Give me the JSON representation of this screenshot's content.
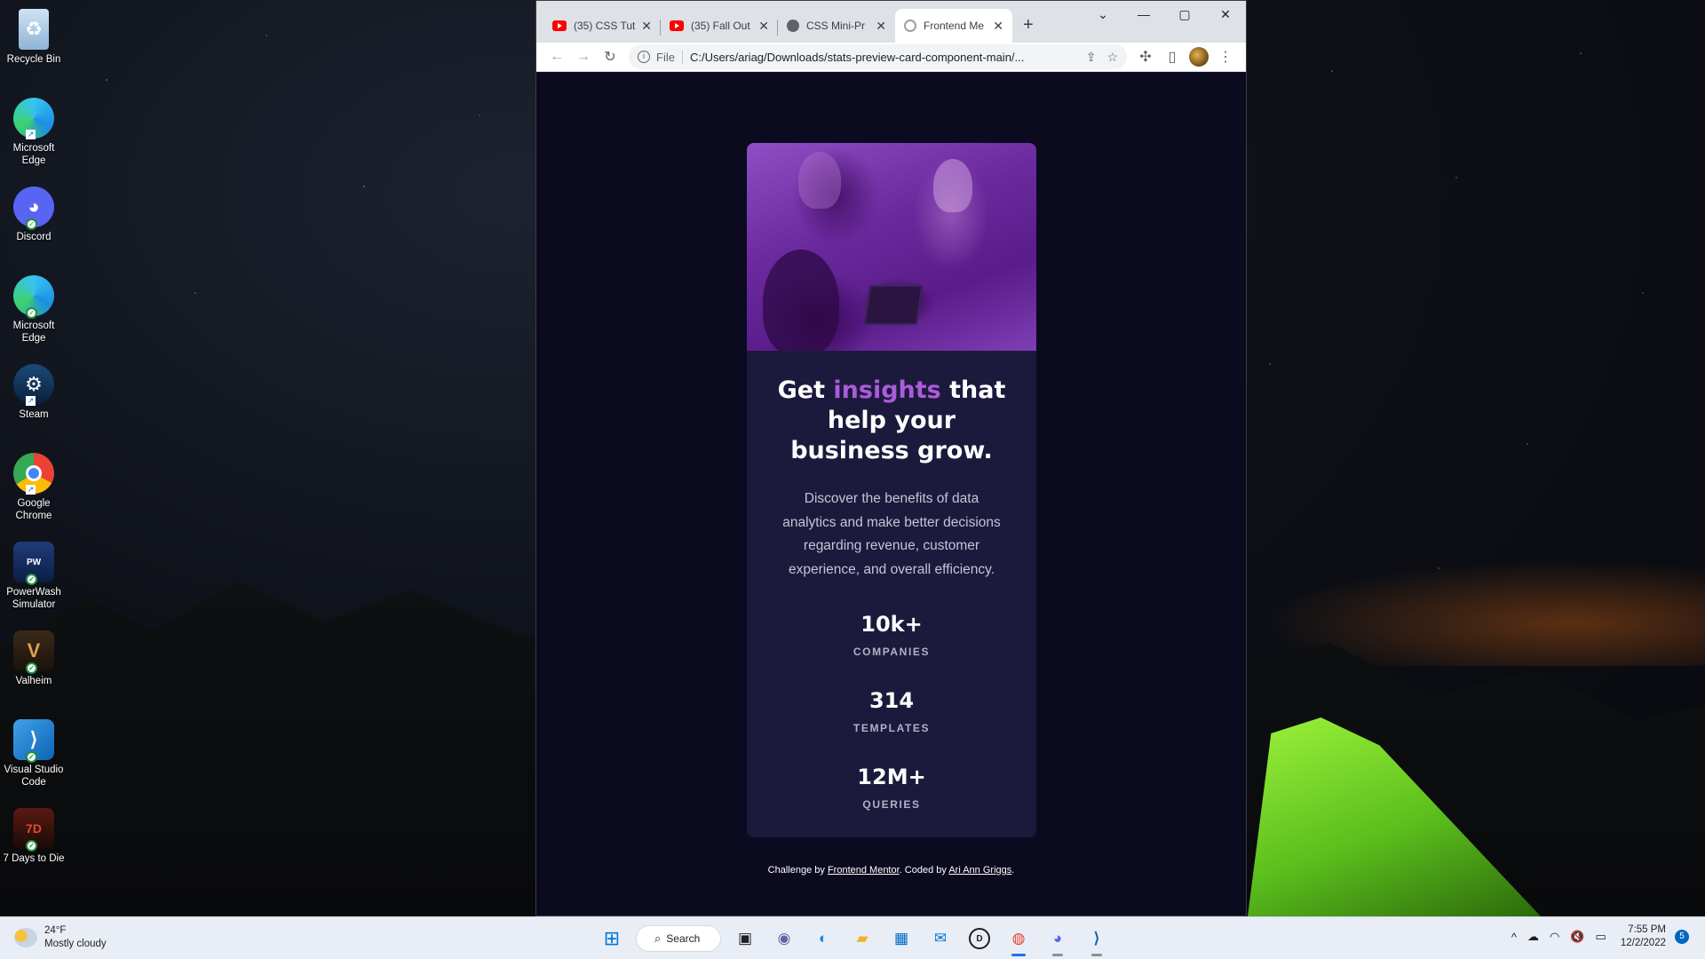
{
  "desktop": {
    "icons": [
      {
        "label": "Recycle Bin",
        "icon": "recycle-bin-icon"
      },
      {
        "label": "Microsoft Edge",
        "icon": "edge-icon"
      },
      {
        "label": "Discord",
        "icon": "discord-icon"
      },
      {
        "label": "Microsoft Edge",
        "icon": "edge-icon"
      },
      {
        "label": "Steam",
        "icon": "steam-icon"
      },
      {
        "label": "Google Chrome",
        "icon": "chrome-icon"
      },
      {
        "label": "PowerWash Simulator",
        "icon": "powerwash-icon"
      },
      {
        "label": "Valheim",
        "icon": "valheim-icon"
      },
      {
        "label": "Visual Studio Code",
        "icon": "vscode-icon"
      },
      {
        "label": "7 Days to Die",
        "icon": "7days-icon"
      }
    ]
  },
  "browser": {
    "tabs": [
      {
        "title": "(35) CSS Tut",
        "favicon": "youtube-icon"
      },
      {
        "title": "(35) Fall Out",
        "favicon": "youtube-icon"
      },
      {
        "title": "CSS Mini-Pr",
        "favicon": "globe-icon"
      },
      {
        "title": "Frontend Me",
        "favicon": "frontend-mentor-icon",
        "active": true
      }
    ],
    "address": {
      "scheme": "File",
      "url": "C:/Users/ariag/Downloads/stats-preview-card-component-main/..."
    }
  },
  "card": {
    "headline_before": "Get ",
    "headline_accent": "insights",
    "headline_after": " that help your business grow.",
    "description": "Discover the benefits of data analytics and make better decisions regarding revenue, customer experience, and overall efficiency.",
    "stats": [
      {
        "value": "10k+",
        "label": "COMPANIES"
      },
      {
        "value": "314",
        "label": "TEMPLATES"
      },
      {
        "value": "12M+",
        "label": "QUERIES"
      }
    ],
    "accent_color": "#aa5cdb"
  },
  "attribution": {
    "prefix": "Challenge by ",
    "link1": "Frontend Mentor",
    "middle": ". Coded by ",
    "link2": "Ari Ann Griggs",
    "suffix": "."
  },
  "taskbar": {
    "weather_temp": "24°F",
    "weather_desc": "Mostly cloudy",
    "search_label": "Search",
    "time": "7:55 PM",
    "date": "12/2/2022",
    "notification_count": "5"
  }
}
